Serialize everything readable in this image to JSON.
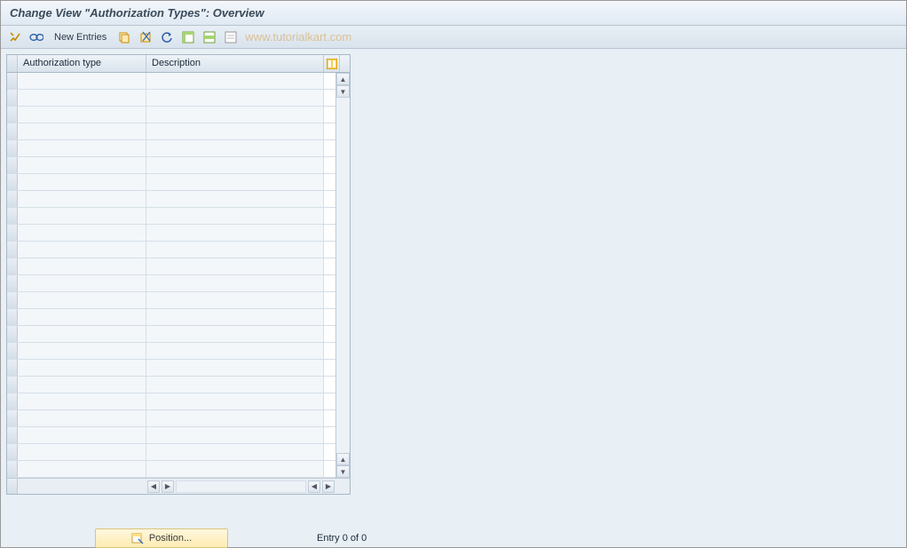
{
  "title": "Change View \"Authorization Types\": Overview",
  "toolbar": {
    "new_entries_label": "New Entries",
    "icons": {
      "toggle": "toggle-display-change-icon",
      "glasses": "details-icon",
      "copy": "copy-icon",
      "delete": "delete-icon",
      "undo": "undo-icon",
      "select_all": "select-all-icon",
      "select_block": "select-block-icon",
      "deselect": "deselect-all-icon"
    }
  },
  "watermark": "www.tutorialkart.com",
  "table": {
    "columns": {
      "auth": "Authorization type",
      "desc": "Description"
    },
    "row_count": 24
  },
  "footer": {
    "position_label": "Position...",
    "entry_status": "Entry 0 of 0"
  }
}
